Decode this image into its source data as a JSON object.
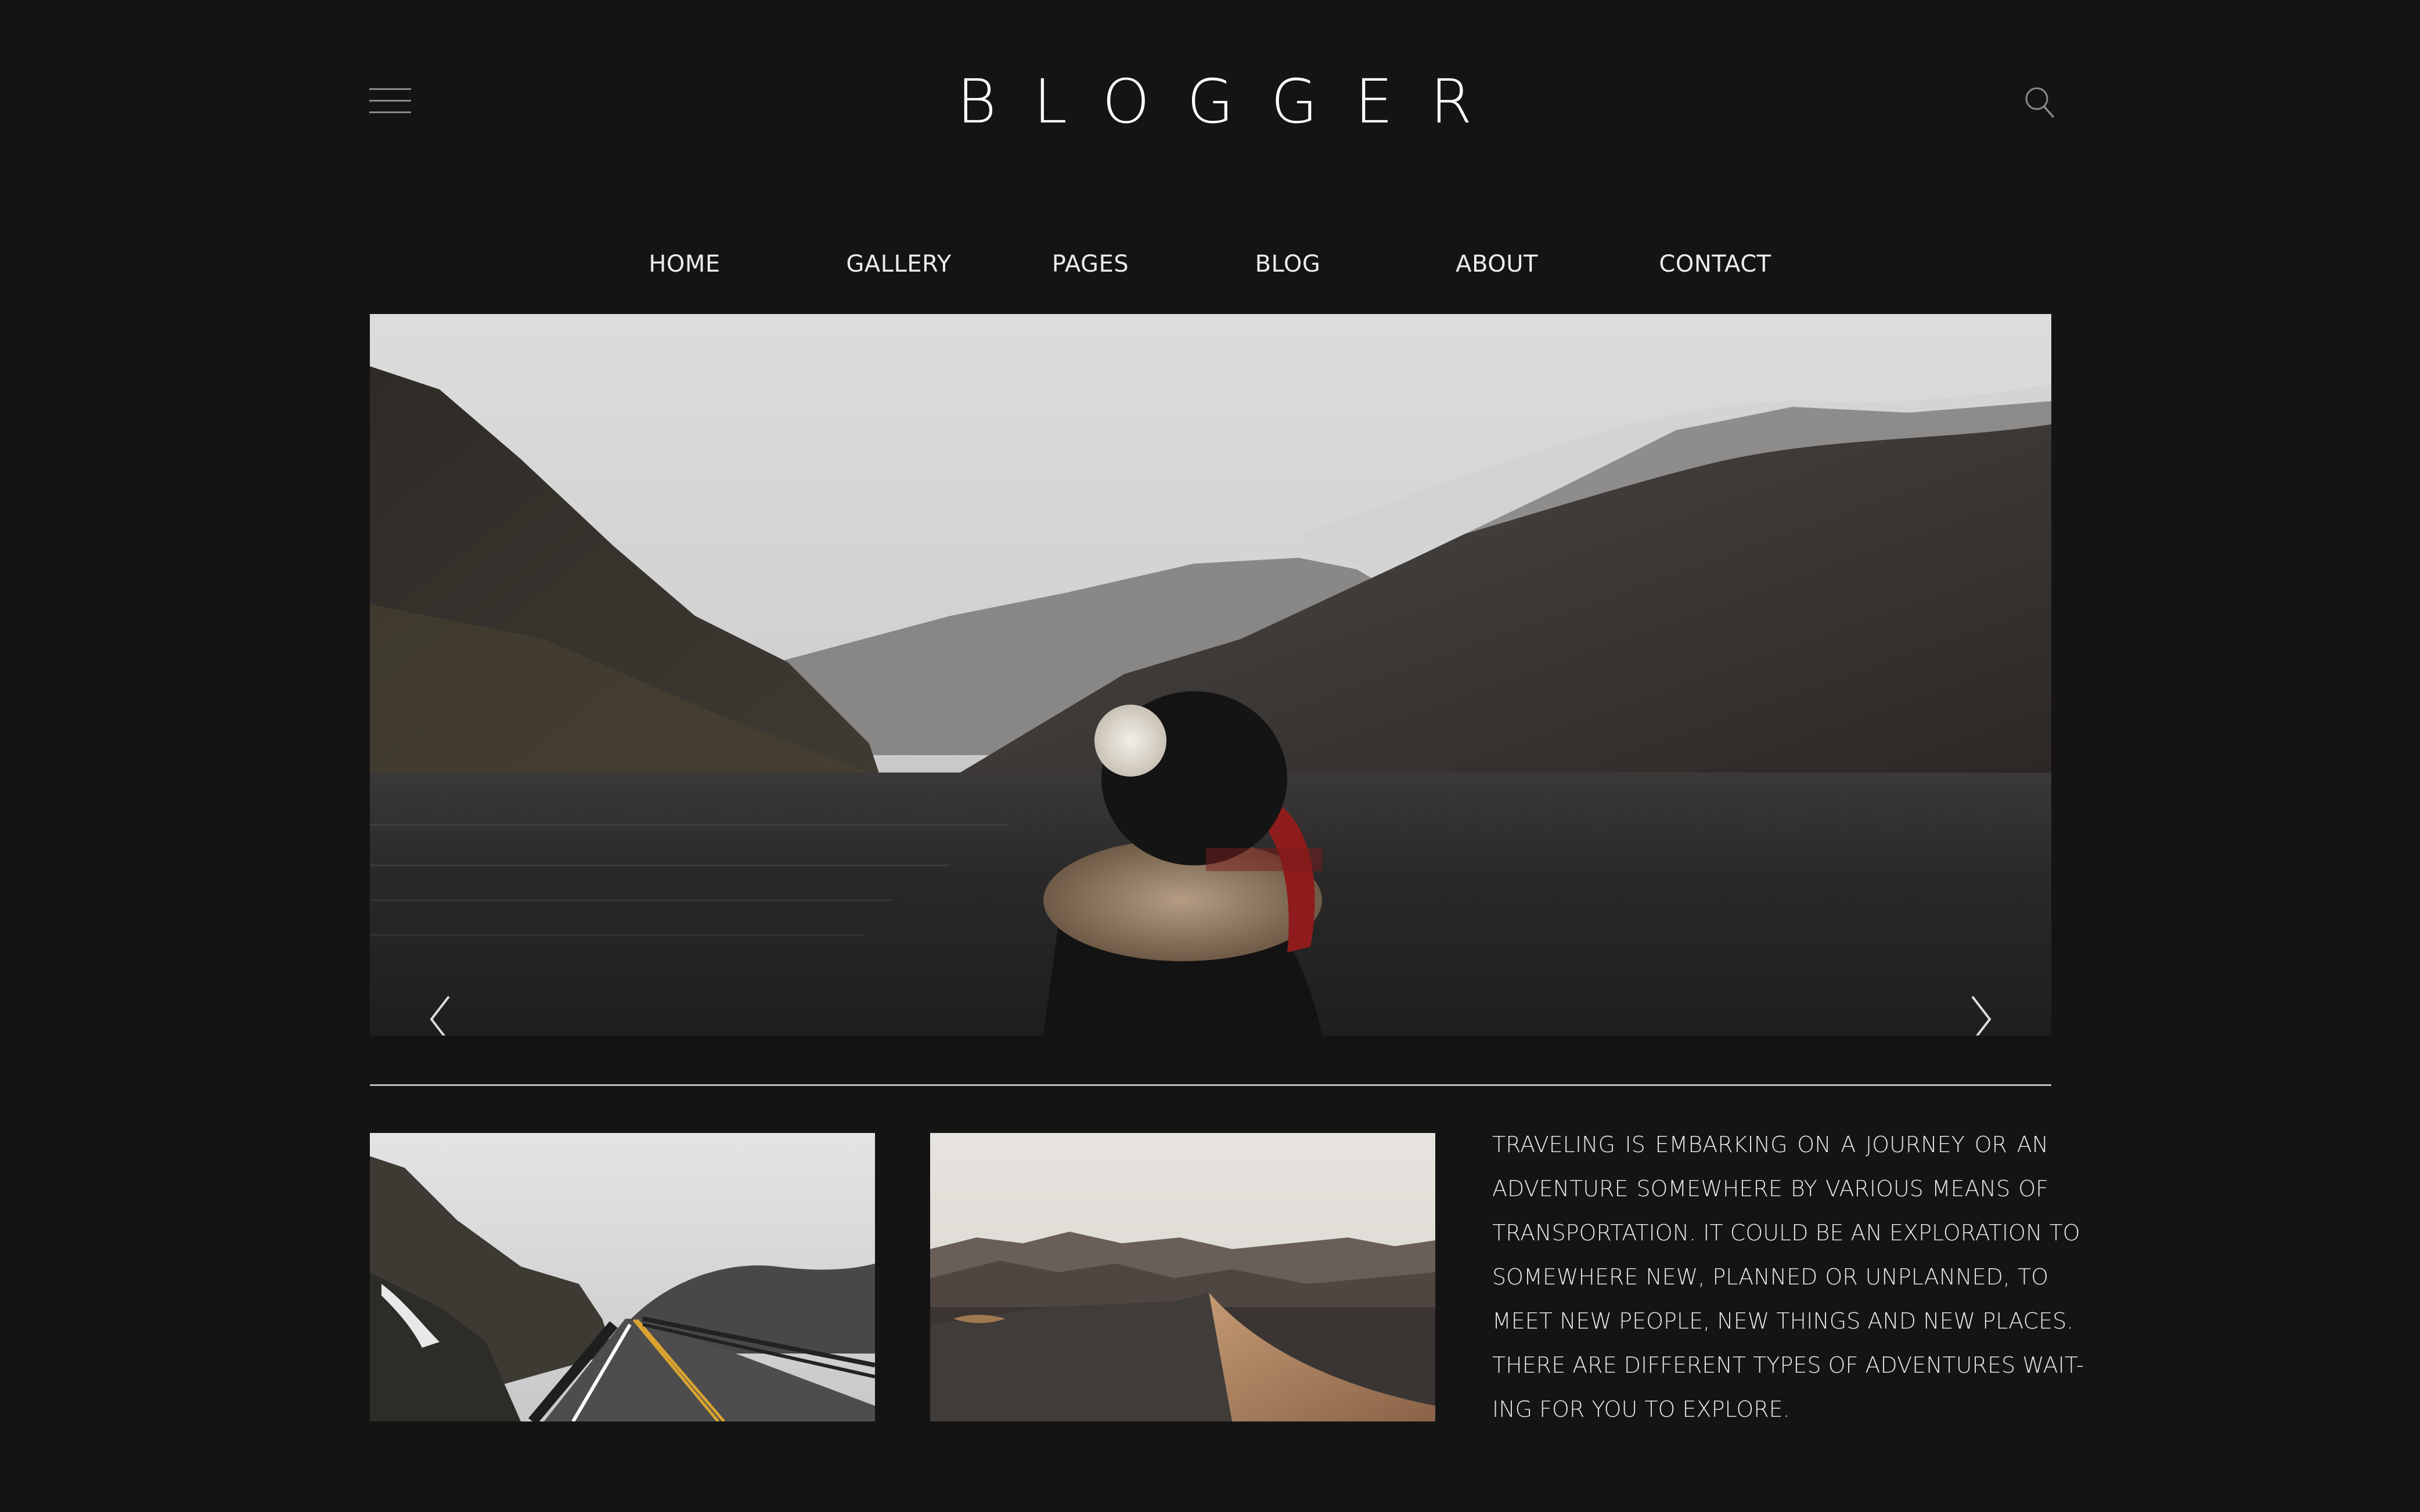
{
  "header": {
    "brand": "BLOGGER",
    "menu_icon": "hamburger-menu-icon",
    "search_icon": "search-icon"
  },
  "nav": {
    "items": [
      {
        "label": "HOME"
      },
      {
        "label": "GALLERY"
      },
      {
        "label": "PAGES"
      },
      {
        "label": "BLOG"
      },
      {
        "label": "ABOUT"
      },
      {
        "label": "CONTACT"
      }
    ]
  },
  "hero": {
    "prev_icon": "chevron-left-icon",
    "next_icon": "chevron-right-icon"
  },
  "article": {
    "lines": [
      "TRAVELING IS EMBARKING ON A JOURNEY OR AN",
      "ADVENTURE SOMEWHERE BY VARIOUS MEANS OF",
      "TRANSPORTATION. IT COULD BE AN EXPLORATION TO",
      "SOMEWHERE NEW, PLANNED OR UNPLANNED, TO",
      "MEET NEW PEOPLE, NEW THINGS AND NEW PLACES.",
      "THERE ARE DIFFERENT TYPES OF ADVENTURES WAIT-",
      "ING FOR YOU TO EXPLORE."
    ]
  },
  "colors": {
    "background": "#141414",
    "text": "#ffffff",
    "divider": "#bdbdbd"
  }
}
